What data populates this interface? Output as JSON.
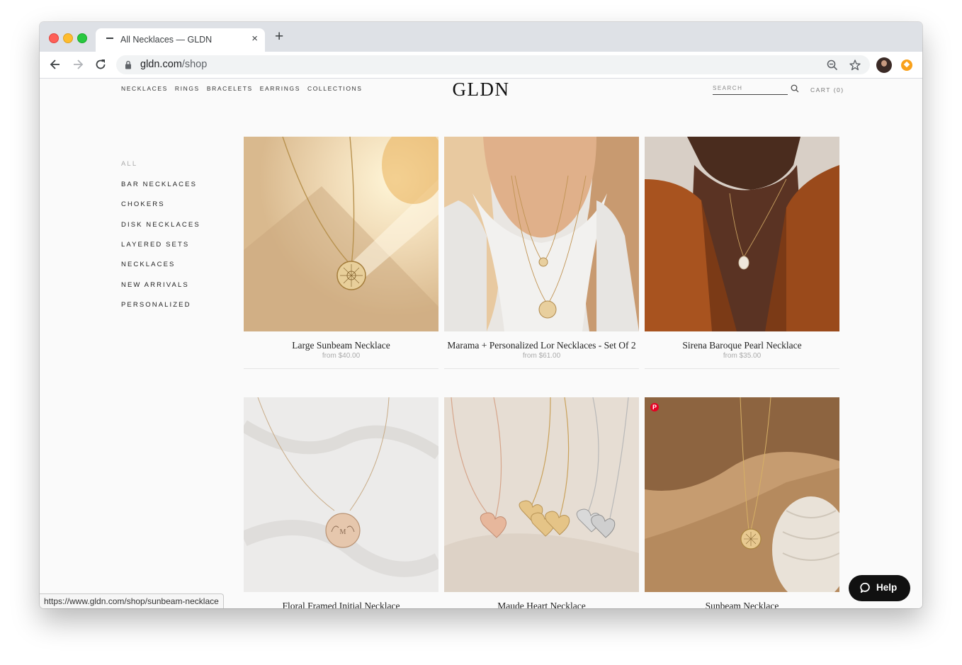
{
  "browser": {
    "tab_title": "All Necklaces — GLDN",
    "tab_close": "×",
    "new_tab": "+",
    "url_host": "gldn.com",
    "url_path": "/shop",
    "status_url": "https://www.gldn.com/shop/sunbeam-necklace"
  },
  "header": {
    "nav": [
      "NECKLACES",
      "RINGS",
      "BRACELETS",
      "EARRINGS",
      "COLLECTIONS"
    ],
    "logo": "GLDN",
    "search_placeholder": "SEARCH",
    "cart": "CART (0)"
  },
  "sidebar": {
    "categories": [
      {
        "label": "ALL",
        "active": true
      },
      {
        "label": "BAR NECKLACES",
        "active": false
      },
      {
        "label": "CHOKERS",
        "active": false
      },
      {
        "label": "DISK NECKLACES",
        "active": false
      },
      {
        "label": "LAYERED SETS",
        "active": false
      },
      {
        "label": "NECKLACES",
        "active": false
      },
      {
        "label": "NEW ARRIVALS",
        "active": false
      },
      {
        "label": "PERSONALIZED",
        "active": false
      }
    ]
  },
  "products": [
    {
      "name": "Large Sunbeam Necklace",
      "price": "from $40.00",
      "image": "sunbeam-disk-on-linen"
    },
    {
      "name": "Marama + Personalized Lor Necklaces - Set Of 2",
      "price": "from $61.00",
      "image": "layered-disks-on-model"
    },
    {
      "name": "Sirena Baroque Pearl Necklace",
      "price": "from $35.00",
      "image": "pearl-pendant-on-model"
    },
    {
      "name": "Floral Framed Initial Necklace",
      "price": "",
      "image": "floral-initial-disk"
    },
    {
      "name": "Maude Heart Necklace",
      "price": "",
      "image": "initial-hearts"
    },
    {
      "name": "Sunbeam Necklace",
      "price": "",
      "image": "sunbeam-disk-vase"
    }
  ],
  "help_widget": {
    "label": "Help"
  },
  "pinterest_badge": "P",
  "colors": {
    "accent_text": "#222222",
    "muted_text": "#aaaaaa",
    "help_bg": "#111111",
    "pinterest": "#e60023"
  }
}
